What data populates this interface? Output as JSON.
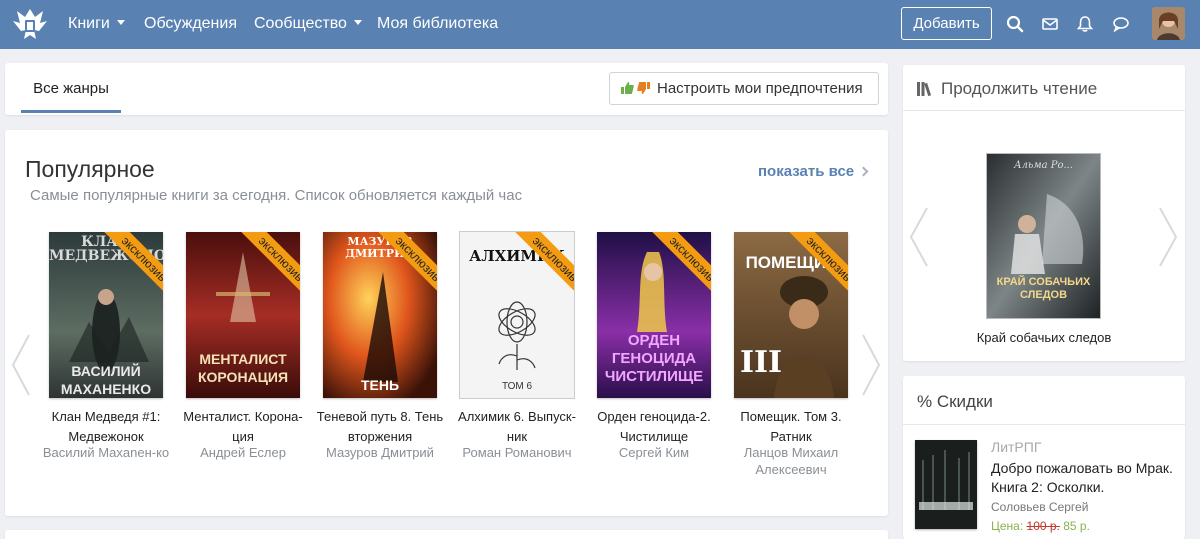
{
  "navbar": {
    "logo": "eagle-logo-icon",
    "links": [
      {
        "label": "Книги",
        "dropdown": true
      },
      {
        "label": "Обсуждения",
        "dropdown": false
      },
      {
        "label": "Сообщество",
        "dropdown": true
      },
      {
        "label": "Моя библиотека",
        "dropdown": false
      }
    ],
    "add_label": "Добавить",
    "icons": [
      "search-icon",
      "mail-icon",
      "bell-icon",
      "chat-icon"
    ],
    "accent": "#5981b1"
  },
  "genres": {
    "active_tab": "Все жанры",
    "prefs_label": "Настроить мои предпочтения"
  },
  "popular": {
    "title": "Популярное",
    "subtitle": "Самые популярные книги за сегодня. Список обновляется каждый час",
    "show_all": "показать все",
    "badge": "эксклюзив",
    "books": [
      {
        "title": "Клан Медведя #1: Медвежонок",
        "author": "Василий Махanен-ко",
        "cover_top": "КЛАН МЕДВЕЖОНОК",
        "cover_bottom": "ВАСИЛИЙ МАХАНЕНКО",
        "cover_colors": [
          "#3d4a49",
          "#6e7c6c"
        ]
      },
      {
        "title": "Менталист. Корона-ция",
        "author": "Андрей Еслер",
        "cover_top": "",
        "cover_bottom": "МЕНТАЛИСТ КОРОНАЦИЯ",
        "cover_colors": [
          "#7a1f1a",
          "#b3312a"
        ]
      },
      {
        "title": "Теневой путь 8. Тень вторжения",
        "author": "Мазуров Дмитрий",
        "cover_top": "МАЗУРОВ ДМИТРИЙ",
        "cover_bottom": "ТЕНЬ ВТОРЖЕНИЯ",
        "cover_colors": [
          "#c7421a",
          "#f0a235"
        ]
      },
      {
        "title": "Алхимик 6. Выпуск-ник",
        "author": "Роман Романович",
        "cover_top": "АЛХИМИК",
        "cover_bottom": "ТОМ 6",
        "cover_colors": [
          "#f4f4f4",
          "#dcdcdc"
        ]
      },
      {
        "title": "Орден геноцида-2. Чистилище",
        "author": "Сергей Ким",
        "cover_top": "",
        "cover_bottom": "ОРДЕН ГЕНОЦИДА ЧИСТИЛИЩЕ",
        "cover_colors": [
          "#3a1d6e",
          "#a33bb4"
        ]
      },
      {
        "title": "Помещик. Том 3. Ратник",
        "author": "Ланцов Михаил Алексеевич",
        "cover_top": "ПОМЕЩИК",
        "cover_bottom": "III",
        "cover_colors": [
          "#6b4b2d",
          "#a07a4e"
        ]
      }
    ]
  },
  "continue_reading": {
    "title": "Продолжить чтение",
    "book_title": "Край собачьих следов",
    "cover_top": "Альма Ро...",
    "cover_bottom": "КРАЙ СОБАЧЬИХ СЛЕДОВ"
  },
  "discounts": {
    "title": "% Скидки",
    "genre": "ЛитРПГ",
    "book_title": "Добро пожаловать во Мрак. Книга 2: Осколки.",
    "author": "Соловьев Сергей",
    "price_label": "Цена:",
    "old_price": "100 р.",
    "new_price": "85 р."
  }
}
